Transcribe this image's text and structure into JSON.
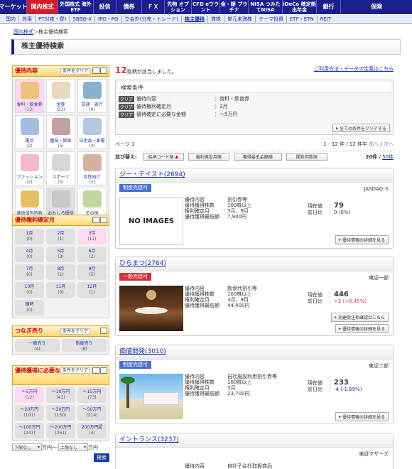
{
  "nav": {
    "items": [
      "マーケット",
      "国内株式",
      "外国株式 海外ETF",
      "投信",
      "債券",
      "ＦＸ",
      "先物 オプション",
      "CFD eワラント",
      "金・銀 プラチナ",
      "NISA つみたてNISA",
      "iDeCo 確定拠出年金",
      "銀行",
      "保険"
    ],
    "active_index": 1,
    "sub": [
      "国内",
      "信用",
      "PTS(夜・昼)",
      "SBBO-X",
      "IPO・PO",
      "立会外(分売・トレード)",
      "株主優待",
      "貸株",
      "単元未満株",
      "テーマ投資",
      "ETF・ETN",
      "REIT"
    ],
    "sub_active_index": 6
  },
  "breadcrumb": {
    "link": "国内株式",
    "current": "＞株主優待検索"
  },
  "page_title": "株主優待検索",
  "side": {
    "content": {
      "title": "優待内容",
      "clear": "条件をクリア",
      "categories": [
        {
          "label": "食料・飲食券",
          "count": "(12)",
          "selected": true
        },
        {
          "label": "金券",
          "count": "(23)",
          "selected": false
        },
        {
          "label": "交通・旅行",
          "count": "(0)",
          "selected": false
        },
        {
          "label": "電台",
          "count": "(2)",
          "selected": false
        },
        {
          "label": "趣味・娯楽",
          "count": "(5)",
          "selected": false
        },
        {
          "label": "日用品・家電",
          "count": "(3)",
          "selected": false
        },
        {
          "label": "ファッション",
          "count": "(2)",
          "selected": false
        },
        {
          "label": "スポーツ",
          "count": "(5)",
          "selected": false
        },
        {
          "label": "女性向け",
          "count": "(2)",
          "selected": false
        },
        {
          "label": "継続保有特典",
          "count": "(8)",
          "selected": false
        },
        {
          "label": "おもしろ優待",
          "count": "(0)",
          "selected": false
        },
        {
          "label": "その他",
          "count": "(13)",
          "selected": false
        }
      ]
    },
    "months": {
      "title": "優待権利確定月",
      "items": [
        {
          "label": "1月",
          "count": "(0)",
          "selected": false
        },
        {
          "label": "2月",
          "count": "(1)",
          "selected": false
        },
        {
          "label": "3月",
          "count": "(12)",
          "selected": true
        },
        {
          "label": "4月",
          "count": "(0)",
          "selected": false
        },
        {
          "label": "5月",
          "count": "(3)",
          "selected": false
        },
        {
          "label": "6月",
          "count": "(2)",
          "selected": false
        },
        {
          "label": "7月",
          "count": "(0)",
          "selected": false
        },
        {
          "label": "8月",
          "count": "(1)",
          "selected": false
        },
        {
          "label": "9月",
          "count": "(5)",
          "selected": false
        },
        {
          "label": "10月",
          "count": "(0)",
          "selected": false
        },
        {
          "label": "11月",
          "count": "(0)",
          "selected": false
        },
        {
          "label": "12月",
          "count": "(1)",
          "selected": false
        },
        {
          "label": "随時",
          "count": "(0)",
          "selected": false
        }
      ]
    },
    "tsunagi": {
      "title": "つなぎ売り",
      "clear": "条件をクリア",
      "items": [
        {
          "label": "一般売り",
          "count": "(4)"
        },
        {
          "label": "制度売り",
          "count": "(8)"
        }
      ]
    },
    "amount": {
      "title": "優待獲得に必要な金額",
      "clear": "条件をクリア",
      "items": [
        {
          "label": "～5万円",
          "count": "(12)",
          "selected": true
        },
        {
          "label": "～10万円",
          "count": "(41)",
          "selected": false
        },
        {
          "label": "～15万円",
          "count": "(73)",
          "selected": false
        },
        {
          "label": "～20万円",
          "count": "(101)",
          "selected": false
        },
        {
          "label": "～30万円",
          "count": "(150)",
          "selected": false
        },
        {
          "label": "～50万円",
          "count": "(214)",
          "selected": false
        },
        {
          "label": "～100万円",
          "count": "(247)",
          "selected": false
        },
        {
          "label": "～200万円",
          "count": "(261)",
          "selected": false
        },
        {
          "label": "200万円超",
          "count": "(4)",
          "selected": false
        }
      ],
      "lower": "下限なし",
      "upper": "上限なし",
      "unit1": "万円～",
      "unit2": "万円",
      "search": "検索"
    }
  },
  "result": {
    "count": "12",
    "count_suffix": "銘柄が該当しました。",
    "help_link": "ご利用方法・データの定義はこちら"
  },
  "conditions": {
    "title": "検索条件",
    "rows": [
      {
        "label": "優待内容",
        "value": "：食料・飲食券"
      },
      {
        "label": "優待権利確定月",
        "value": "：3月"
      },
      {
        "label": "優待確定に必要な金額",
        "value": "：～5万円"
      }
    ],
    "clear_tag": "クリア",
    "clear_all": "全ての条件をクリアする"
  },
  "pager": {
    "page_label": "ページ",
    "page": "1",
    "range": "1 - 12 件 / 12 件中",
    "prev": "前へ",
    "next": "次へ"
  },
  "sort": {
    "label": "並び替え:",
    "buttons": [
      "銘柄コード順",
      "権利確定月順",
      "獲得最低金額順",
      "閲覧回数順"
    ],
    "per_page_current": "20件",
    "per_page_link": "50件"
  },
  "stocks": [
    {
      "name": "ジー・テイスト(2694)",
      "tag": "制度売建可",
      "tag_color": "#4a6fd0",
      "market": "JASDAQ･S",
      "no_image": "NO IMAGES",
      "content": "割引券等",
      "shares": "100株以上",
      "months": "3月、9月",
      "min": "7,900円",
      "price": "79",
      "change": "0 (0%)",
      "change_dir": "none",
      "detail": "優待情報の詳細を見る"
    },
    {
      "name": "ひらまつ(2764)",
      "tag": "一般売建可",
      "tag_color": "#d0323a",
      "market": "東証一部",
      "content": "飲食代割引等",
      "shares": "100株以上",
      "months": "3月、9月",
      "min": "44,400円",
      "price": "446",
      "change": "+2 (+0.45%)",
      "change_dir": "up",
      "extra": "売建受注枠確認はこちら",
      "detail": "優待情報の詳細を見る"
    },
    {
      "name": "価値開発(3010)",
      "tag": "制度売建可",
      "tag_color": "#4a6fd0",
      "market": "東証二部",
      "content": "自社施設利用割引券等",
      "shares": "100株以上",
      "months": "3月",
      "min": "23,700円",
      "price": "233",
      "change": "-4 (-1.69%)",
      "change_dir": "down",
      "detail": "優待情報の詳細を見る"
    },
    {
      "name": "イントランス(3237)",
      "market": "東証マザーズ",
      "content": "自社子会社取扱商品"
    }
  ],
  "labels": {
    "content": "優待内容",
    "shares": "優待獲得株数",
    "months": "権利確定月",
    "min": "優待獲得最低額",
    "price": "現在値",
    "change": "前日比"
  }
}
